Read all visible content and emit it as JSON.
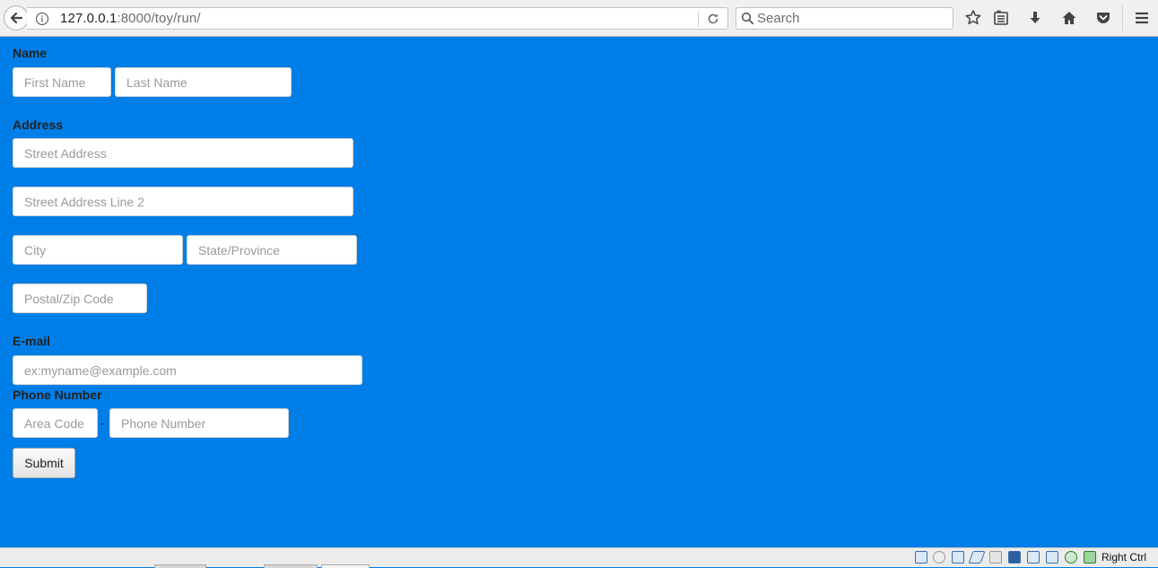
{
  "browser": {
    "url_host": "127.0.0.1",
    "url_path": ":8000/toy/run/",
    "search_placeholder": "Search"
  },
  "form": {
    "name_label": "Name",
    "first_name_placeholder": "First Name",
    "last_name_placeholder": "Last Name",
    "address_label": "Address",
    "street_placeholder": "Street Address",
    "street2_placeholder": "Street Address Line 2",
    "city_placeholder": "City",
    "state_placeholder": "State/Province",
    "zip_placeholder": "Postal/Zip Code",
    "email_label": "E-mail",
    "email_placeholder": "ex:myname@example.com",
    "phone_label": "Phone Number",
    "area_code_placeholder": "Area Code",
    "phone_separator": "-",
    "phone_placeholder": "Phone Number",
    "submit_label": "Submit"
  },
  "statusbar": {
    "host_key": "Right Ctrl"
  },
  "colors": {
    "page_background": "#007ee8"
  }
}
